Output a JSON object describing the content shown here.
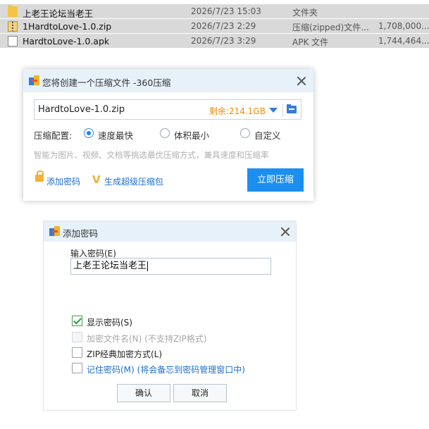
{
  "files": [
    {
      "name": "上老王论坛当老王",
      "date": "2026/7/23 15:03",
      "type": "文件夹",
      "size": "",
      "icon": "folder-icon"
    },
    {
      "name": "1HardtoLove-1.0.zip",
      "date": "2026/7/23 2:29",
      "type": "压缩(zipped)文件...",
      "size": "1,708,000...",
      "icon": "zip-icon"
    },
    {
      "name": "HardtoLove-1.0.apk",
      "date": "2026/7/23 3:29",
      "type": "APK 文件",
      "size": "1,744,464...",
      "icon": "file-icon"
    }
  ],
  "compress_dialog": {
    "title": "您将创建一个压缩文件 -360压缩",
    "output_path": "HardtoLove-1.0.zip",
    "free_space": "剩余:214.1GB",
    "config_label": "压缩配置:",
    "options": [
      {
        "label": "速度最快",
        "selected": true
      },
      {
        "label": "体积最小",
        "selected": false
      },
      {
        "label": "自定义",
        "selected": false
      }
    ],
    "hint": "智能为图片、视频、文档等挑选最优压缩方式，兼具速度和压缩率",
    "add_password_link": "添加密码",
    "super_pack_link": "生成超级压缩包",
    "compress_button": "立即压缩",
    "accent_color": "#1b8ef0"
  },
  "password_dialog": {
    "title": "添加密码",
    "input_label": "输入密码(E)",
    "password_value": "上老王论坛当老王",
    "checkboxes": [
      {
        "label": "显示密码(S)",
        "checked": true,
        "disabled": false
      },
      {
        "label": "加密文件名(N) (不支持ZIP格式)",
        "checked": false,
        "disabled": true
      },
      {
        "label": "ZIP经典加密方式(L)",
        "checked": false,
        "disabled": false
      },
      {
        "label": "记住密码(M) (将会备忘到密码管理窗口中)",
        "checked": false,
        "disabled": false
      }
    ],
    "ok_button": "确认",
    "cancel_button": "取消"
  }
}
